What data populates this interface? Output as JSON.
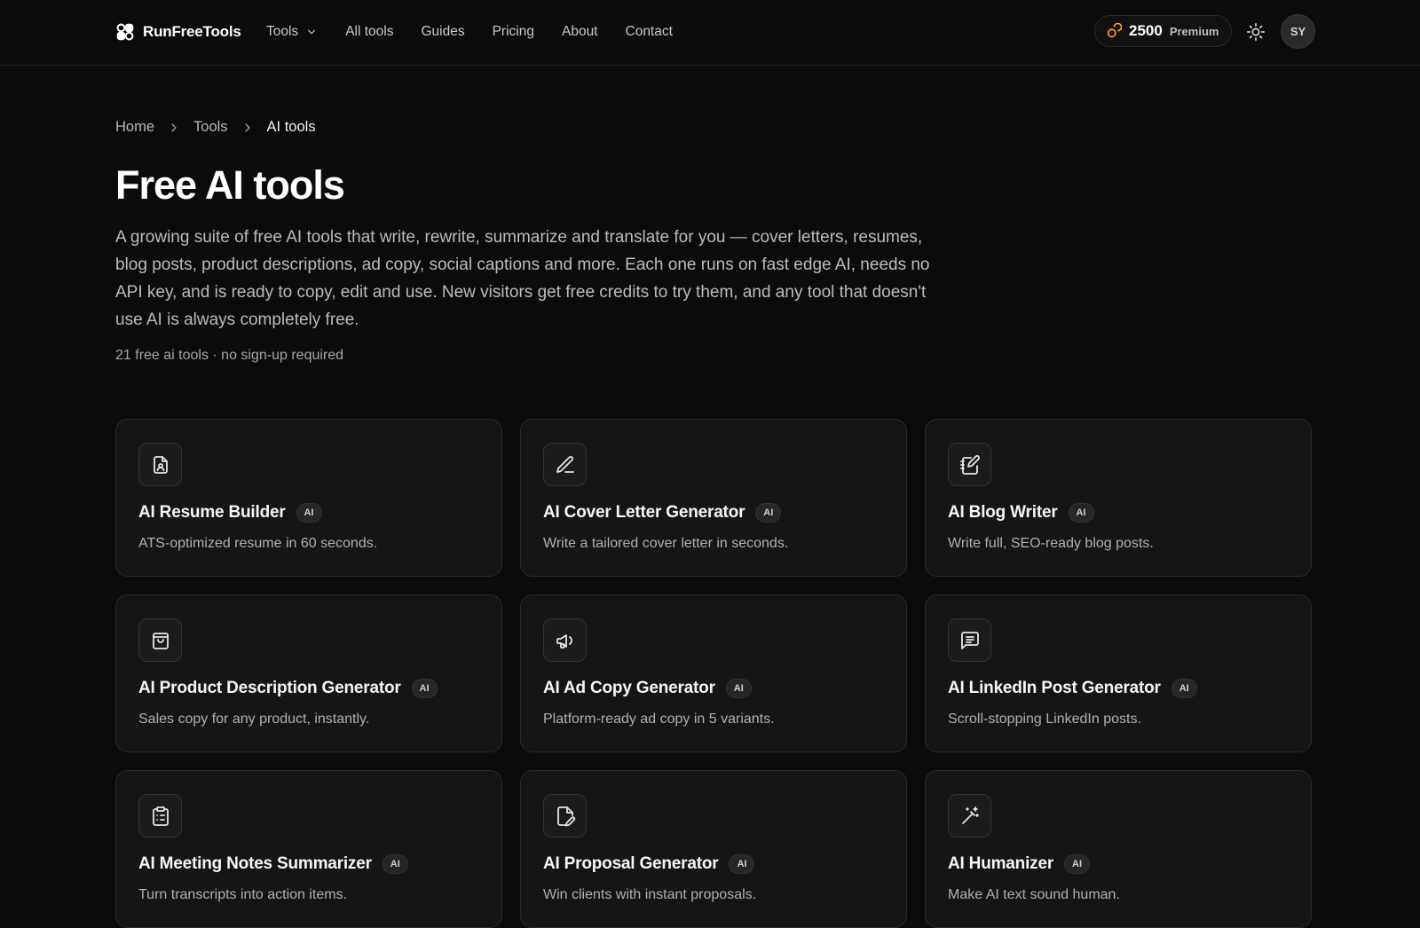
{
  "header": {
    "brand": "RunFreeTools",
    "nav": [
      {
        "label": "Tools",
        "has_dropdown": true
      },
      {
        "label": "All tools"
      },
      {
        "label": "Guides"
      },
      {
        "label": "Pricing"
      },
      {
        "label": "About"
      },
      {
        "label": "Contact"
      }
    ],
    "credits": {
      "count": "2500",
      "tier": "Premium",
      "icon": "coins-icon",
      "color": "#f5a524"
    },
    "theme_toggle_icon": "sun-icon",
    "avatar_initials": "SY"
  },
  "breadcrumb": [
    "Home",
    "Tools",
    "AI tools"
  ],
  "page": {
    "title": "Free AI tools",
    "description": "A growing suite of free AI tools that write, rewrite, summarize and translate for you — cover letters, resumes, blog posts, product descriptions, ad copy, social captions and more. Each one runs on fast edge AI, needs no API key, and is ready to copy, edit and use. New visitors get free credits to try them, and any tool that doesn't use AI is always completely free.",
    "meta": "21 free ai tools · no sign-up required"
  },
  "cards": [
    {
      "title": "AI Resume Builder",
      "badge": "AI",
      "desc": "ATS-optimized resume in 60 seconds.",
      "icon": "resume-icon"
    },
    {
      "title": "AI Cover Letter Generator",
      "badge": "AI",
      "desc": "Write a tailored cover letter in seconds.",
      "icon": "pen-icon"
    },
    {
      "title": "AI Blog Writer",
      "badge": "AI",
      "desc": "Write full, SEO-ready blog posts.",
      "icon": "notebook-pen-icon"
    },
    {
      "title": "AI Product Description Generator",
      "badge": "AI",
      "desc": "Sales copy for any product, instantly.",
      "icon": "shopping-bag-icon"
    },
    {
      "title": "AI Ad Copy Generator",
      "badge": "AI",
      "desc": "Platform-ready ad copy in 5 variants.",
      "icon": "megaphone-icon"
    },
    {
      "title": "AI LinkedIn Post Generator",
      "badge": "AI",
      "desc": "Scroll-stopping LinkedIn posts.",
      "icon": "message-text-icon"
    },
    {
      "title": "AI Meeting Notes Summarizer",
      "badge": "AI",
      "desc": "Turn transcripts into action items.",
      "icon": "clipboard-list-icon"
    },
    {
      "title": "AI Proposal Generator",
      "badge": "AI",
      "desc": "Win clients with instant proposals.",
      "icon": "file-pen-icon"
    },
    {
      "title": "AI Humanizer",
      "badge": "AI",
      "desc": "Make AI text sound human.",
      "icon": "magic-wand-icon"
    }
  ]
}
